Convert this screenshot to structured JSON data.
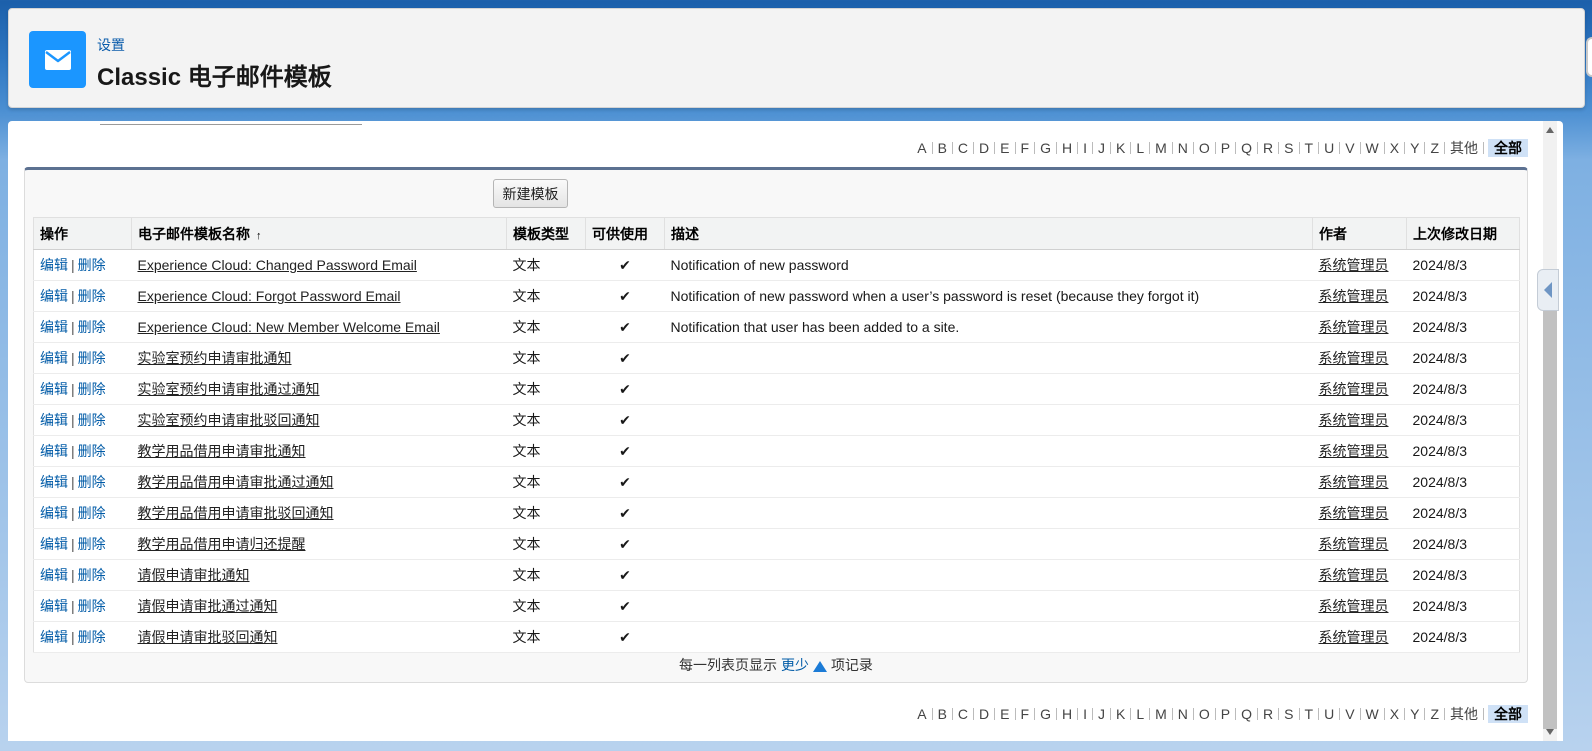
{
  "header": {
    "breadcrumb": "设置",
    "title": "Classic 电子邮件模板",
    "icon": "envelope-icon",
    "icon_color": "#1b96ff"
  },
  "alphabet": {
    "letters": [
      "A",
      "B",
      "C",
      "D",
      "E",
      "F",
      "G",
      "H",
      "I",
      "J",
      "K",
      "L",
      "M",
      "N",
      "O",
      "P",
      "Q",
      "R",
      "S",
      "T",
      "U",
      "V",
      "W",
      "X",
      "Y",
      "Z",
      "其他"
    ],
    "all_label": "全部"
  },
  "toolbar": {
    "new_template_label": "新建模板"
  },
  "table": {
    "columns": {
      "action": "操作",
      "name": "电子邮件模板名称",
      "type": "模板类型",
      "available": "可供使用",
      "description": "描述",
      "author": "作者",
      "modified": "上次修改日期"
    },
    "sort_indicator": "↑",
    "edit_label": "编辑",
    "delete_label": "删除",
    "check_glyph": "✔",
    "rows": [
      {
        "name": "Experience Cloud: Changed Password Email",
        "type": "文本",
        "available": true,
        "description": "Notification of new password",
        "author": "系统管理员",
        "modified": "2024/8/3"
      },
      {
        "name": "Experience Cloud: Forgot Password Email",
        "type": "文本",
        "available": true,
        "description": "Notification of new password when a user’s password is reset (because they forgot it)",
        "author": "系统管理员",
        "modified": "2024/8/3"
      },
      {
        "name": "Experience Cloud: New Member Welcome Email",
        "type": "文本",
        "available": true,
        "description": "Notification that user has been added to a site.",
        "author": "系统管理员",
        "modified": "2024/8/3"
      },
      {
        "name": "实验室预约申请审批通知",
        "type": "文本",
        "available": true,
        "description": "",
        "author": "系统管理员",
        "modified": "2024/8/3"
      },
      {
        "name": "实验室预约申请审批通过通知",
        "type": "文本",
        "available": true,
        "description": "",
        "author": "系统管理员",
        "modified": "2024/8/3"
      },
      {
        "name": "实验室预约申请审批驳回通知",
        "type": "文本",
        "available": true,
        "description": "",
        "author": "系统管理员",
        "modified": "2024/8/3"
      },
      {
        "name": "教学用品借用申请审批通知",
        "type": "文本",
        "available": true,
        "description": "",
        "author": "系统管理员",
        "modified": "2024/8/3"
      },
      {
        "name": "教学用品借用申请审批通过通知",
        "type": "文本",
        "available": true,
        "description": "",
        "author": "系统管理员",
        "modified": "2024/8/3"
      },
      {
        "name": "教学用品借用申请审批驳回通知",
        "type": "文本",
        "available": true,
        "description": "",
        "author": "系统管理员",
        "modified": "2024/8/3"
      },
      {
        "name": "教学用品借用申请归还提醒",
        "type": "文本",
        "available": true,
        "description": "",
        "author": "系统管理员",
        "modified": "2024/8/3"
      },
      {
        "name": "请假申请审批通知",
        "type": "文本",
        "available": true,
        "description": "",
        "author": "系统管理员",
        "modified": "2024/8/3"
      },
      {
        "name": "请假申请审批通过通知",
        "type": "文本",
        "available": true,
        "description": "",
        "author": "系统管理员",
        "modified": "2024/8/3"
      },
      {
        "name": "请假申请审批驳回通知",
        "type": "文本",
        "available": true,
        "description": "",
        "author": "系统管理员",
        "modified": "2024/8/3"
      }
    ]
  },
  "pager": {
    "prefix": "每一列表页显示",
    "fewer_label": "更少",
    "suffix": "项记录"
  },
  "colors": {
    "link": "#015ba7",
    "accent": "#1b96ff",
    "list_border": "#5c7191",
    "header_bg": "#f3f3f3"
  }
}
